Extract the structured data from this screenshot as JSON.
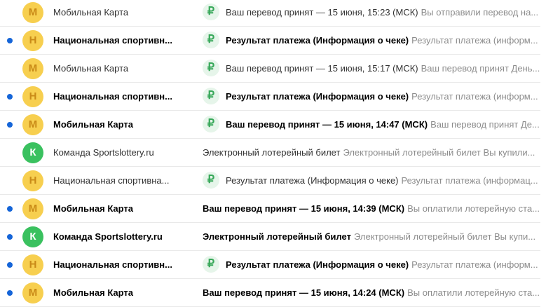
{
  "colors": {
    "avatar_m": "#f7cf4f",
    "avatar_n": "#f7cf4f",
    "avatar_k": "#3ac15f",
    "avatar_letter_m": "#c98a17",
    "avatar_letter_n": "#c98a17",
    "avatar_letter_k": "#ffffff",
    "unread_dot": "#1565d8",
    "payment_icon": "#38a85a"
  },
  "payment_icon_glyph": "₽",
  "emails": [
    {
      "unread": false,
      "avatar": "М",
      "avatar_kind": "m",
      "sender": "Мобильная Карта",
      "has_icon": true,
      "subject": "Ваш перевод принят — 15 июня, 15:23 (МСК)",
      "snippet": "Вы отправили перевод на..."
    },
    {
      "unread": true,
      "avatar": "Н",
      "avatar_kind": "n",
      "sender": "Национальная спортивн...",
      "has_icon": true,
      "subject": "Результат платежа (Информация о чеке)",
      "snippet": "Результат платежа (информ..."
    },
    {
      "unread": false,
      "avatar": "М",
      "avatar_kind": "m",
      "sender": "Мобильная Карта",
      "has_icon": true,
      "subject": "Ваш перевод принят — 15 июня, 15:17 (МСК)",
      "snippet": "Ваш перевод принят День..."
    },
    {
      "unread": true,
      "avatar": "Н",
      "avatar_kind": "n",
      "sender": "Национальная спортивн...",
      "has_icon": true,
      "subject": "Результат платежа (Информация о чеке)",
      "snippet": "Результат платежа (информ..."
    },
    {
      "unread": true,
      "avatar": "М",
      "avatar_kind": "m",
      "sender": "Мобильная Карта",
      "has_icon": true,
      "subject": "Ваш перевод принят — 15 июня, 14:47 (МСК)",
      "snippet": "Ваш перевод принят Де..."
    },
    {
      "unread": false,
      "avatar": "К",
      "avatar_kind": "k",
      "sender": "Команда Sportslottery.ru",
      "has_icon": false,
      "subject": "Электронный лотерейный билет",
      "snippet": "Электронный лотерейный билет Вы купили..."
    },
    {
      "unread": false,
      "avatar": "Н",
      "avatar_kind": "n",
      "sender": "Национальная спортивна...",
      "has_icon": true,
      "subject": "Результат платежа (Информация о чеке)",
      "snippet": "Результат платежа (информац..."
    },
    {
      "unread": true,
      "avatar": "М",
      "avatar_kind": "m",
      "sender": "Мобильная Карта",
      "has_icon": false,
      "subject": "Ваш перевод принят — 15 июня, 14:39 (МСК)",
      "snippet": "Вы оплатили лотерейную ста..."
    },
    {
      "unread": true,
      "avatar": "К",
      "avatar_kind": "k",
      "sender": "Команда Sportslottery.ru",
      "has_icon": false,
      "subject": "Электронный лотерейный билет",
      "snippet": "Электронный лотерейный билет Вы купи..."
    },
    {
      "unread": true,
      "avatar": "Н",
      "avatar_kind": "n",
      "sender": "Национальная спортивн...",
      "has_icon": true,
      "subject": "Результат платежа (Информация о чеке)",
      "snippet": "Результат платежа (информ..."
    },
    {
      "unread": true,
      "avatar": "М",
      "avatar_kind": "m",
      "sender": "Мобильная Карта",
      "has_icon": false,
      "subject": "Ваш перевод принят — 15 июня, 14:24 (МСК)",
      "snippet": "Вы оплатили лотерейную ста..."
    }
  ]
}
